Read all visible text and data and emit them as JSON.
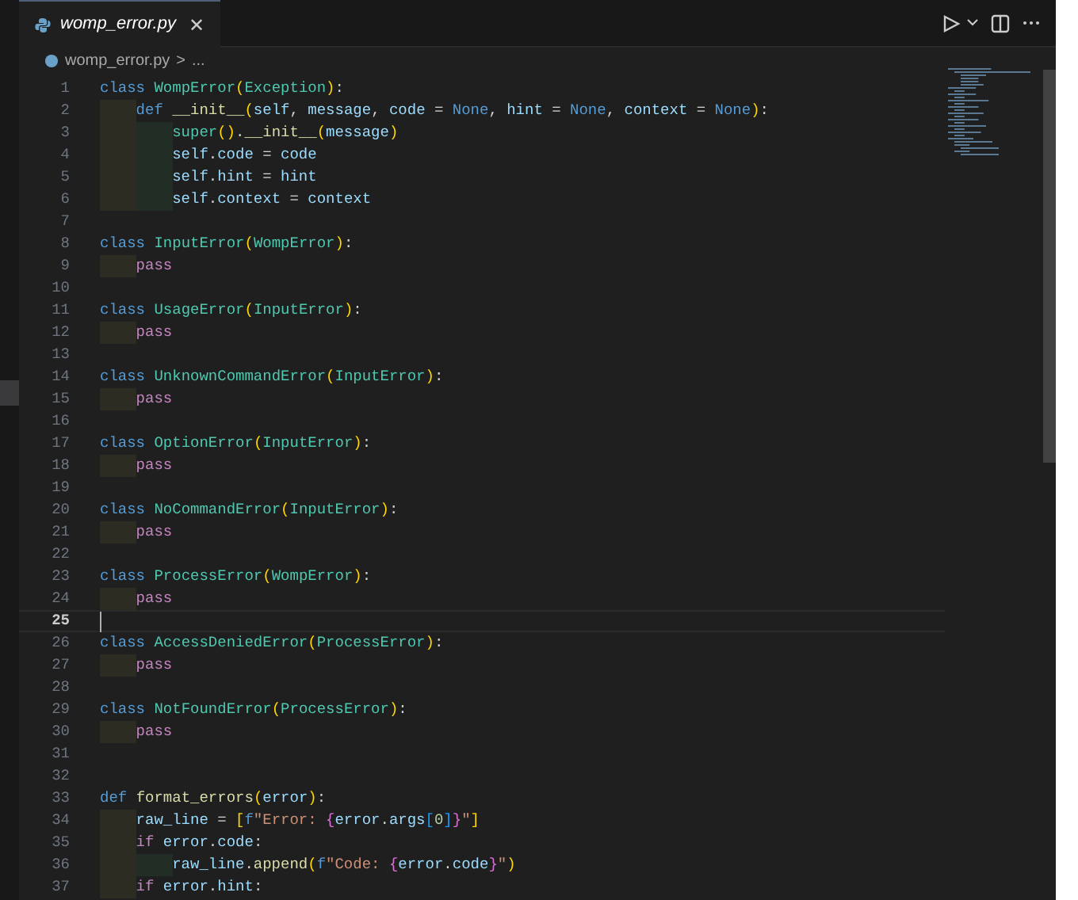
{
  "tabs": [
    {
      "label": "womp_error.py",
      "selected": true,
      "close": "✕"
    }
  ],
  "breadcrumb": {
    "file": "womp_error.py",
    "separator": ">",
    "more": "..."
  },
  "editor": {
    "lines": [
      {
        "number": "1",
        "tokens": [
          {
            "kind": "kw",
            "text": "class "
          },
          {
            "kind": "cls",
            "text": "WompError"
          },
          {
            "kind": "p1",
            "text": "("
          },
          {
            "kind": "cls",
            "text": "Exception"
          },
          {
            "kind": "p1",
            "text": ")"
          },
          {
            "kind": "op",
            "text": ":"
          }
        ],
        "children": [
          {
            "number": "2",
            "tokens": [
              {
                "kind": "kw",
                "text": "def "
              },
              {
                "kind": "fn",
                "text": "__init__"
              },
              {
                "kind": "p1",
                "text": "("
              },
              {
                "kind": "var",
                "text": "self"
              },
              {
                "kind": "op",
                "text": ", "
              },
              {
                "kind": "var",
                "text": "message"
              },
              {
                "kind": "op",
                "text": ", "
              },
              {
                "kind": "var",
                "text": "code"
              },
              {
                "kind": "op",
                "text": " = "
              },
              {
                "kind": "kw",
                "text": "None"
              },
              {
                "kind": "op",
                "text": ", "
              },
              {
                "kind": "var",
                "text": "hint"
              },
              {
                "kind": "op",
                "text": " = "
              },
              {
                "kind": "kw",
                "text": "None"
              },
              {
                "kind": "op",
                "text": ", "
              },
              {
                "kind": "var",
                "text": "context"
              },
              {
                "kind": "op",
                "text": " = "
              },
              {
                "kind": "kw",
                "text": "None"
              },
              {
                "kind": "p1",
                "text": ")"
              },
              {
                "kind": "op",
                "text": ":"
              }
            ],
            "children": [
              {
                "number": "3",
                "tokens": [
                  {
                    "kind": "cls",
                    "text": "super"
                  },
                  {
                    "kind": "p1",
                    "text": "()"
                  },
                  {
                    "kind": "op",
                    "text": "."
                  },
                  {
                    "kind": "fn",
                    "text": "__init__"
                  },
                  {
                    "kind": "p1",
                    "text": "("
                  },
                  {
                    "kind": "var",
                    "text": "message"
                  },
                  {
                    "kind": "p1",
                    "text": ")"
                  }
                ]
              },
              {
                "number": "4",
                "tokens": [
                  {
                    "kind": "var",
                    "text": "self"
                  },
                  {
                    "kind": "op",
                    "text": "."
                  },
                  {
                    "kind": "var",
                    "text": "code"
                  },
                  {
                    "kind": "op",
                    "text": " = "
                  },
                  {
                    "kind": "var",
                    "text": "code"
                  }
                ]
              },
              {
                "number": "5",
                "tokens": [
                  {
                    "kind": "var",
                    "text": "self"
                  },
                  {
                    "kind": "op",
                    "text": "."
                  },
                  {
                    "kind": "var",
                    "text": "hint"
                  },
                  {
                    "kind": "op",
                    "text": " = "
                  },
                  {
                    "kind": "var",
                    "text": "hint"
                  }
                ]
              },
              {
                "number": "6",
                "tokens": [
                  {
                    "kind": "var",
                    "text": "self"
                  },
                  {
                    "kind": "op",
                    "text": "."
                  },
                  {
                    "kind": "var",
                    "text": "context"
                  },
                  {
                    "kind": "op",
                    "text": " = "
                  },
                  {
                    "kind": "var",
                    "text": "context"
                  }
                ]
              }
            ]
          }
        ]
      },
      {
        "number": "7"
      },
      {
        "number": "8",
        "tokens": [
          {
            "kind": "kw",
            "text": "class "
          },
          {
            "kind": "cls",
            "text": "InputError"
          },
          {
            "kind": "p1",
            "text": "("
          },
          {
            "kind": "cls",
            "text": "WompError"
          },
          {
            "kind": "p1",
            "text": ")"
          },
          {
            "kind": "op",
            "text": ":"
          }
        ],
        "children": [
          {
            "number": "9",
            "tokens": [
              {
                "kind": "ctl",
                "text": "pass"
              }
            ]
          }
        ]
      },
      {
        "number": "10"
      },
      {
        "number": "11",
        "tokens": [
          {
            "kind": "kw",
            "text": "class "
          },
          {
            "kind": "cls",
            "text": "UsageError"
          },
          {
            "kind": "p1",
            "text": "("
          },
          {
            "kind": "cls",
            "text": "InputError"
          },
          {
            "kind": "p1",
            "text": ")"
          },
          {
            "kind": "op",
            "text": ":"
          }
        ],
        "children": [
          {
            "number": "12",
            "tokens": [
              {
                "kind": "ctl",
                "text": "pass"
              }
            ]
          }
        ]
      },
      {
        "number": "13"
      },
      {
        "number": "14",
        "tokens": [
          {
            "kind": "kw",
            "text": "class "
          },
          {
            "kind": "cls",
            "text": "UnknownCommandError"
          },
          {
            "kind": "p1",
            "text": "("
          },
          {
            "kind": "cls",
            "text": "InputError"
          },
          {
            "kind": "p1",
            "text": ")"
          },
          {
            "kind": "op",
            "text": ":"
          }
        ],
        "children": [
          {
            "number": "15",
            "tokens": [
              {
                "kind": "ctl",
                "text": "pass"
              }
            ]
          }
        ]
      },
      {
        "number": "16"
      },
      {
        "number": "17",
        "tokens": [
          {
            "kind": "kw",
            "text": "class "
          },
          {
            "kind": "cls",
            "text": "OptionError"
          },
          {
            "kind": "p1",
            "text": "("
          },
          {
            "kind": "cls",
            "text": "InputError"
          },
          {
            "kind": "p1",
            "text": ")"
          },
          {
            "kind": "op",
            "text": ":"
          }
        ],
        "children": [
          {
            "number": "18",
            "tokens": [
              {
                "kind": "ctl",
                "text": "pass"
              }
            ]
          }
        ]
      },
      {
        "number": "19"
      },
      {
        "number": "20",
        "tokens": [
          {
            "kind": "kw",
            "text": "class "
          },
          {
            "kind": "cls",
            "text": "NoCommandError"
          },
          {
            "kind": "p1",
            "text": "("
          },
          {
            "kind": "cls",
            "text": "InputError"
          },
          {
            "kind": "p1",
            "text": ")"
          },
          {
            "kind": "op",
            "text": ":"
          }
        ],
        "children": [
          {
            "number": "21",
            "tokens": [
              {
                "kind": "ctl",
                "text": "pass"
              }
            ]
          }
        ]
      },
      {
        "number": "22"
      },
      {
        "number": "23",
        "tokens": [
          {
            "kind": "kw",
            "text": "class "
          },
          {
            "kind": "cls",
            "text": "ProcessError"
          },
          {
            "kind": "p1",
            "text": "("
          },
          {
            "kind": "cls",
            "text": "WompError"
          },
          {
            "kind": "p1",
            "text": ")"
          },
          {
            "kind": "op",
            "text": ":"
          }
        ],
        "children": [
          {
            "number": "24",
            "tokens": [
              {
                "kind": "ctl",
                "text": "pass"
              }
            ]
          }
        ]
      },
      {
        "number": "25",
        "current": true
      },
      {
        "number": "26",
        "tokens": [
          {
            "kind": "kw",
            "text": "class "
          },
          {
            "kind": "cls",
            "text": "AccessDeniedError"
          },
          {
            "kind": "p1",
            "text": "("
          },
          {
            "kind": "cls",
            "text": "ProcessError"
          },
          {
            "kind": "p1",
            "text": ")"
          },
          {
            "kind": "op",
            "text": ":"
          }
        ],
        "children": [
          {
            "number": "27",
            "tokens": [
              {
                "kind": "ctl",
                "text": "pass"
              }
            ]
          }
        ]
      },
      {
        "number": "28"
      },
      {
        "number": "29",
        "tokens": [
          {
            "kind": "kw",
            "text": "class "
          },
          {
            "kind": "cls",
            "text": "NotFoundError"
          },
          {
            "kind": "p1",
            "text": "("
          },
          {
            "kind": "cls",
            "text": "ProcessError"
          },
          {
            "kind": "p1",
            "text": ")"
          },
          {
            "kind": "op",
            "text": ":"
          }
        ],
        "children": [
          {
            "number": "30",
            "tokens": [
              {
                "kind": "ctl",
                "text": "pass"
              }
            ]
          }
        ]
      },
      {
        "number": "31"
      },
      {
        "number": "32"
      },
      {
        "number": "33",
        "tokens": [
          {
            "kind": "kw",
            "text": "def "
          },
          {
            "kind": "fn",
            "text": "format_errors"
          },
          {
            "kind": "p1",
            "text": "("
          },
          {
            "kind": "var",
            "text": "error"
          },
          {
            "kind": "p1",
            "text": ")"
          },
          {
            "kind": "op",
            "text": ":"
          }
        ],
        "children": [
          {
            "number": "34",
            "tokens": [
              {
                "kind": "var",
                "text": "raw_line"
              },
              {
                "kind": "op",
                "text": " = "
              },
              {
                "kind": "p1",
                "text": "["
              },
              {
                "kind": "kw",
                "text": "f"
              },
              {
                "kind": "str",
                "text": "\"Error: "
              },
              {
                "kind": "p2",
                "text": "{"
              },
              {
                "kind": "var",
                "text": "error"
              },
              {
                "kind": "op",
                "text": "."
              },
              {
                "kind": "var",
                "text": "args"
              },
              {
                "kind": "p3",
                "text": "["
              },
              {
                "kind": "num",
                "text": "0"
              },
              {
                "kind": "p3",
                "text": "]"
              },
              {
                "kind": "p2",
                "text": "}"
              },
              {
                "kind": "str",
                "text": "\""
              },
              {
                "kind": "p1",
                "text": "]"
              }
            ]
          },
          {
            "number": "35",
            "tokens": [
              {
                "kind": "ctl",
                "text": "if "
              },
              {
                "kind": "var",
                "text": "error"
              },
              {
                "kind": "op",
                "text": "."
              },
              {
                "kind": "var",
                "text": "code"
              },
              {
                "kind": "op",
                "text": ":"
              }
            ],
            "children": [
              {
                "number": "36",
                "tokens": [
                  {
                    "kind": "var",
                    "text": "raw_line"
                  },
                  {
                    "kind": "op",
                    "text": "."
                  },
                  {
                    "kind": "fn",
                    "text": "append"
                  },
                  {
                    "kind": "p1",
                    "text": "("
                  },
                  {
                    "kind": "kw",
                    "text": "f"
                  },
                  {
                    "kind": "str",
                    "text": "\"Code: "
                  },
                  {
                    "kind": "p2",
                    "text": "{"
                  },
                  {
                    "kind": "var",
                    "text": "error"
                  },
                  {
                    "kind": "op",
                    "text": "."
                  },
                  {
                    "kind": "var",
                    "text": "code"
                  },
                  {
                    "kind": "p2",
                    "text": "}"
                  },
                  {
                    "kind": "str",
                    "text": "\""
                  },
                  {
                    "kind": "p1",
                    "text": ")"
                  }
                ]
              }
            ]
          },
          {
            "number": "37",
            "tokens": [
              {
                "kind": "ctl",
                "text": "if "
              },
              {
                "kind": "var",
                "text": "error"
              },
              {
                "kind": "op",
                "text": "."
              },
              {
                "kind": "var",
                "text": "hint"
              },
              {
                "kind": "op",
                "text": ":"
              }
            ]
          }
        ]
      }
    ]
  }
}
